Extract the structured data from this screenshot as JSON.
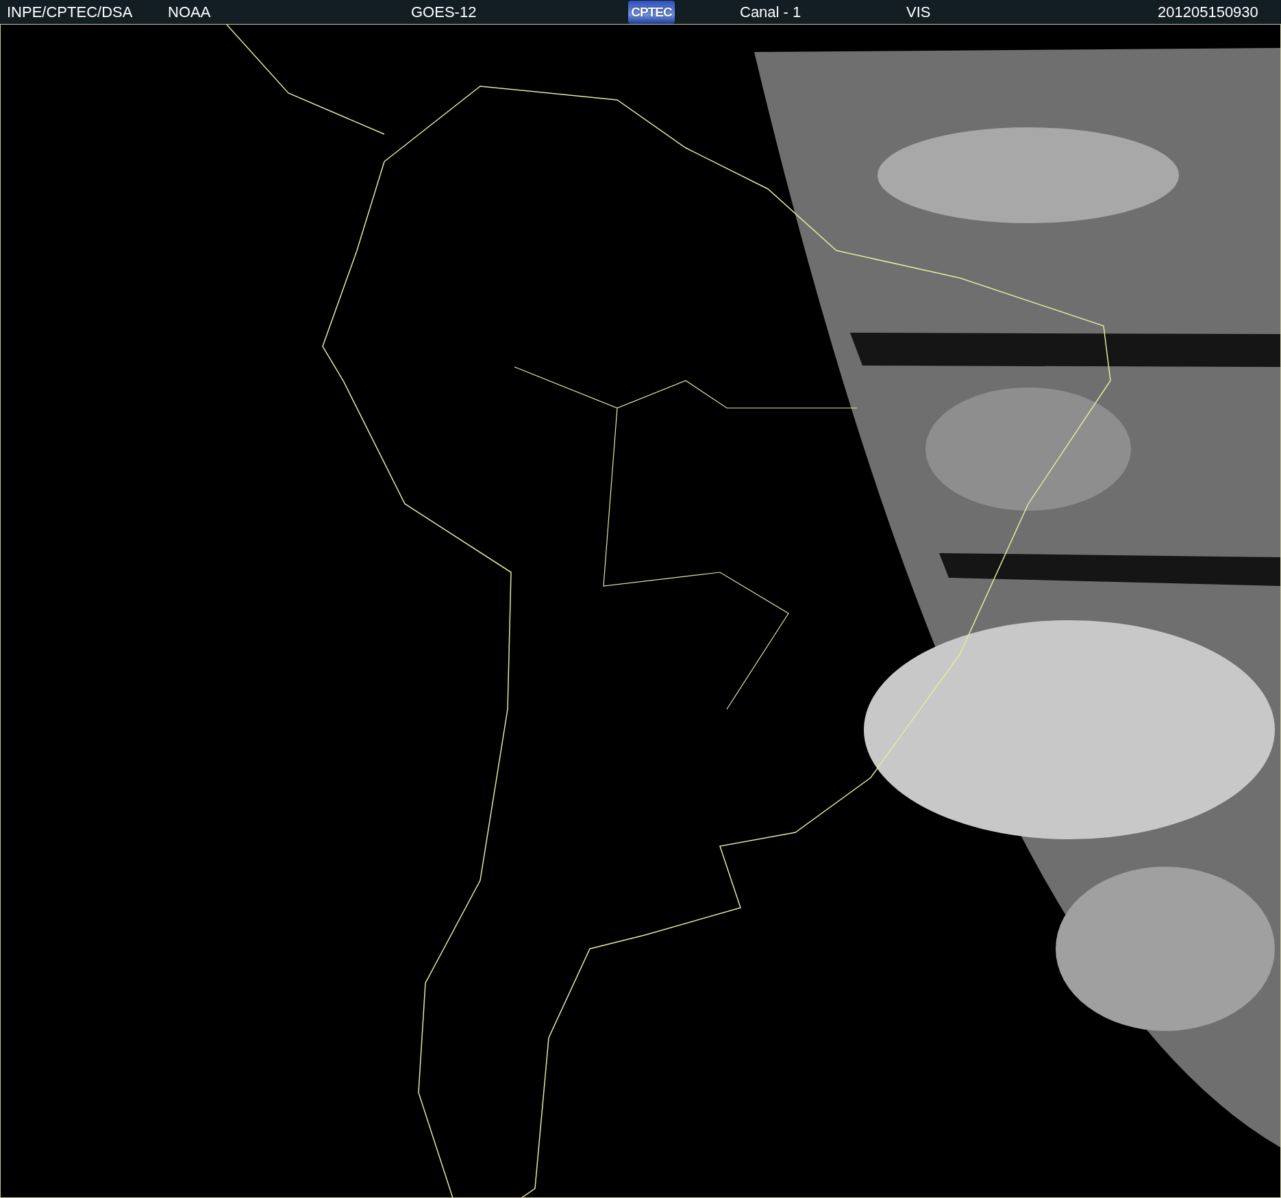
{
  "header": {
    "source": "INPE/CPTEC/DSA",
    "agency": "NOAA",
    "satellite": "GOES-12",
    "logo": "CPTEC",
    "channel": "Canal - 1",
    "band": "VIS",
    "timestamp": "201205150930"
  }
}
